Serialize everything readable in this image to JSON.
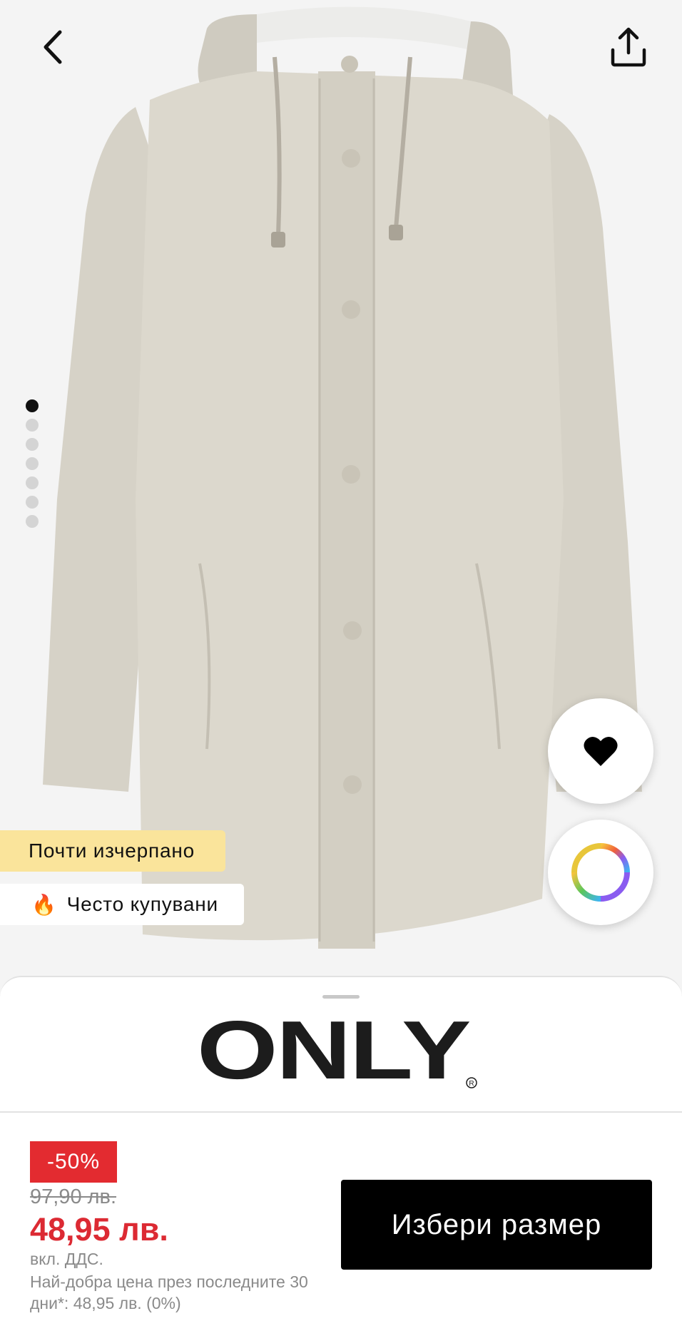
{
  "header": {
    "back_icon": "chevron-left-icon",
    "share_icon": "share-upload-icon"
  },
  "gallery": {
    "image_count": 7,
    "active_index": 0,
    "product_color": "#d9d6cc"
  },
  "badges": {
    "low_stock": "Почти изчерпано",
    "popular": "Често купувани",
    "popular_icon": "🔥"
  },
  "actions": {
    "wishlist_icon": "heart-icon",
    "colors_icon": "color-wheel-icon"
  },
  "brand": {
    "name": "ONLY",
    "registered_mark": "R"
  },
  "pricing": {
    "discount": "-50%",
    "old_price": "97,90 лв.",
    "new_price": "48,95 лв.",
    "vat_note": "вкл. ДДС.",
    "best_price_note": "Най-добра цена през последните 30 дни*: 48,95 лв. (0%)",
    "discount_color": "#e32b30",
    "price_color": "#dc2a33"
  },
  "cta": {
    "select_size_label": "Избери размер"
  }
}
